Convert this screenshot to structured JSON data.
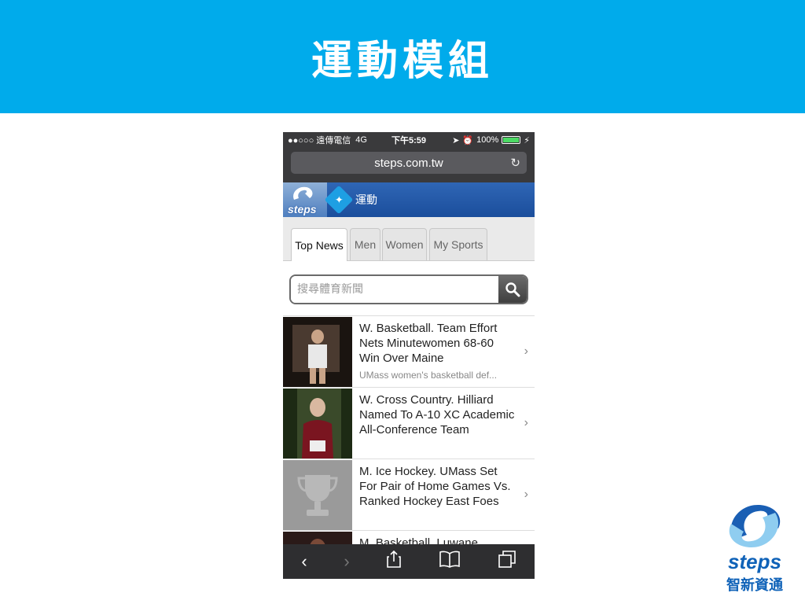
{
  "slide": {
    "title": "運動模組"
  },
  "status": {
    "carrier": "●●○○○ 遠傳電信",
    "network": "4G",
    "time": "下午5:59",
    "battery": "100%",
    "battery_level": 1.0
  },
  "browser": {
    "url": "steps.com.tw"
  },
  "app": {
    "title": "運動",
    "logo_text": "steps"
  },
  "tabs": [
    {
      "label": "Top News",
      "active": true
    },
    {
      "label": "Men"
    },
    {
      "label": "Women"
    },
    {
      "label": "My Sports"
    }
  ],
  "search": {
    "placeholder": "搜尋體育新聞"
  },
  "news": [
    {
      "title": "W. Basketball. Team Effort Nets Minutewomen 68-60 Win Over Maine",
      "summary": "UMass women's basketball def..."
    },
    {
      "title": "W. Cross Country. Hilliard Named To A-10 XC Academic All-Conference Team"
    },
    {
      "title": "M. Ice Hockey. UMass Set For Pair of Home Games Vs. Ranked Hockey East Foes"
    },
    {
      "title": "M. Basketball. Luwane"
    }
  ],
  "brand": {
    "name": "steps",
    "chinese": "智新資通"
  },
  "colors": {
    "banner": "#00abeb",
    "appbar": "#2f66b5",
    "brand": "#0f62b8"
  }
}
